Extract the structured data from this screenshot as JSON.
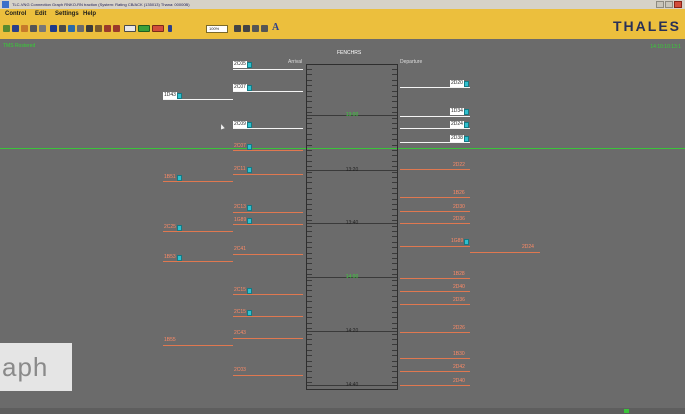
{
  "window": {
    "title": "TLC-VNG Connection Graph RNKO-RN traction (System: Rating CB/ACK (135013) Thana: 00000B)"
  },
  "menu": [
    "Control",
    "Edit",
    "Settings",
    "Help"
  ],
  "toolbar": {
    "zoom": "100%",
    "text_button": "A"
  },
  "brand": {
    "name": "THALES",
    "color": "#283058"
  },
  "status": {
    "left": "TMS Rostered",
    "right": "14:10:10:13:1"
  },
  "station": "FENCHRS",
  "columns": {
    "arrival": "Arrival",
    "departure": "Departure"
  },
  "graph": {
    "times": [
      "13:00",
      "13:20",
      "13:40",
      "14:00",
      "14:20",
      "14:40"
    ],
    "green_times": [
      "13:00",
      "14:00"
    ]
  },
  "trains": {
    "left_white": [
      "2C05",
      "2C07",
      "2C09",
      "2C07",
      "2C11",
      "2C13",
      "2C15",
      "1G89"
    ],
    "far_left": [
      "1D43",
      "1B51",
      "2C25",
      "1B53",
      "1B55"
    ],
    "left_orange": [
      "2C41",
      "2C43",
      "2C03"
    ],
    "right": [
      "2D20",
      "1D34",
      "2D24",
      "2D38",
      "2D22",
      "1B26",
      "2D30",
      "2D36",
      "1G89",
      "1B28",
      "2D40",
      "2D36",
      "2D26",
      "1B30",
      "2D42",
      "2D40"
    ],
    "far_right": [
      "2D24"
    ]
  },
  "watermark": "aph",
  "colors": {
    "background": "#6b6b6b",
    "menubar": "#ecbf3d",
    "status_green": "#35d035",
    "train_orange": "#e07850",
    "badge_cyan": "#2fc0cf"
  },
  "icons": [
    "app-icon",
    "open-folder-icon",
    "save-icon",
    "filter-icon",
    "print-icon",
    "preview-icon",
    "train-icon",
    "settings-icon",
    "chart-icon",
    "grid-icon",
    "search-icon",
    "eye-icon",
    "config-icon",
    "config-icon",
    "view-a-icon",
    "view-b-icon",
    "view-c-icon",
    "info-icon",
    "zoom-in-icon",
    "zoom-out-icon",
    "zoom-fit-icon",
    "zoom-area-icon",
    "text-icon",
    "minimize-icon",
    "maximize-icon",
    "close-icon",
    "pointer-cursor-icon"
  ]
}
